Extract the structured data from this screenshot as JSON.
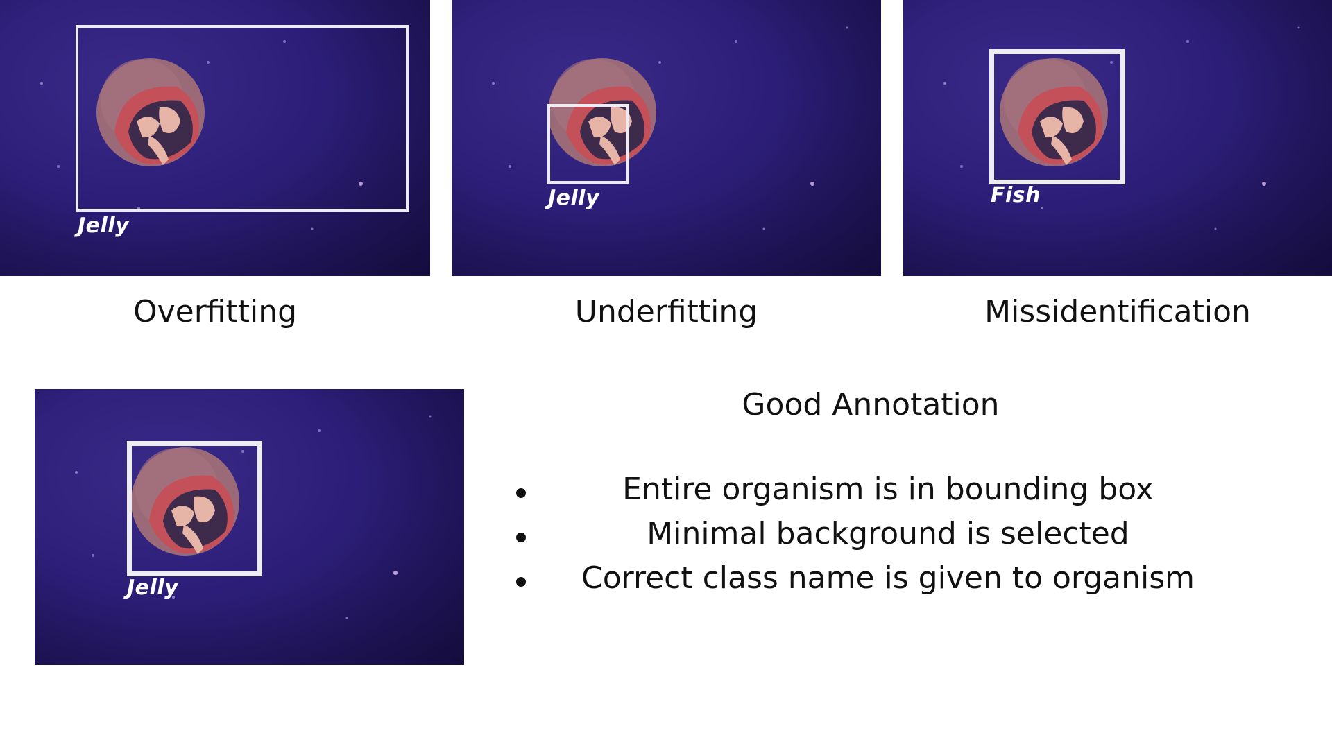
{
  "panels": [
    {
      "id": "overfitting",
      "caption": "Overfitting",
      "label": "Jelly"
    },
    {
      "id": "underfitting",
      "caption": "Underfitting",
      "label": "Jelly"
    },
    {
      "id": "missidentification",
      "caption": "Missidentification",
      "label": "Fish"
    },
    {
      "id": "good",
      "caption": "",
      "label": "Jelly"
    }
  ],
  "good_annotation": {
    "title": "Good Annotation",
    "bullets": [
      "Entire organism is in bounding box",
      "Minimal background is selected",
      "Correct class name is given to organism"
    ]
  },
  "colors": {
    "water": "#2c1e78",
    "box": "#ececf2",
    "jelly_bell": "#9a6a78",
    "jelly_red": "#c4505a",
    "jelly_inner": "#e7b4a8"
  },
  "icons": [
    "jellyfish-image",
    "bullet-dot"
  ]
}
